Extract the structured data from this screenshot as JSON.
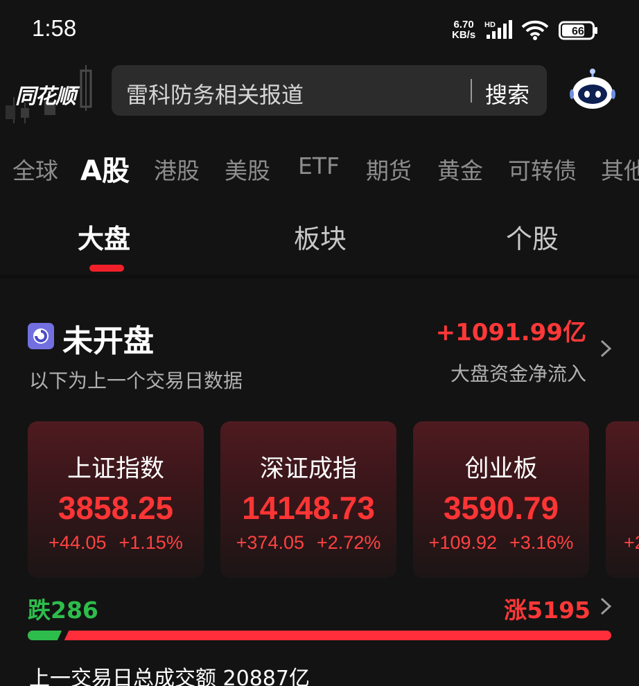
{
  "status_bar": {
    "time": "1:58",
    "net_speed_value": "6.70",
    "net_speed_unit": "KB/s",
    "network_badge": "HD",
    "battery": "66"
  },
  "header": {
    "logo_text": "同花顺",
    "search_placeholder": "雷科防务相关报道",
    "search_button": "搜索",
    "assistant_icon": "robot-icon"
  },
  "market_tabs": [
    "全球",
    "A股",
    "港股",
    "美股",
    "ETF",
    "期货",
    "黄金",
    "可转债",
    "其他"
  ],
  "market_tab_active": "A股",
  "sub_tabs": [
    "大盘",
    "板块",
    "个股"
  ],
  "sub_tab_active": "大盘",
  "market_status": {
    "title": "未开盘",
    "subtitle": "以下为上一个交易日数据",
    "net_inflow": "+1091.99亿",
    "net_inflow_label": "大盘资金净流入"
  },
  "indices": [
    {
      "name": "上证指数",
      "value": "3858.25",
      "change": "+44.05",
      "pct": "+1.15%"
    },
    {
      "name": "深证成指",
      "value": "14148.73",
      "change": "+374.05",
      "pct": "+2.72%"
    },
    {
      "name": "创业板",
      "value": "3590.79",
      "change": "+109.92",
      "pct": "+3.16%"
    },
    {
      "name": "",
      "value": "",
      "change": "+2",
      "pct": ""
    }
  ],
  "breadth": {
    "fall_text": "跌286",
    "rise_text": "涨5195",
    "fall_count": 286,
    "rise_count": 5195
  },
  "turnover": "上一交易日总成交额 20887亿",
  "colors": {
    "up": "#ff3838",
    "down": "#2dbd4c",
    "accent": "#f0202a",
    "background": "#131313"
  }
}
